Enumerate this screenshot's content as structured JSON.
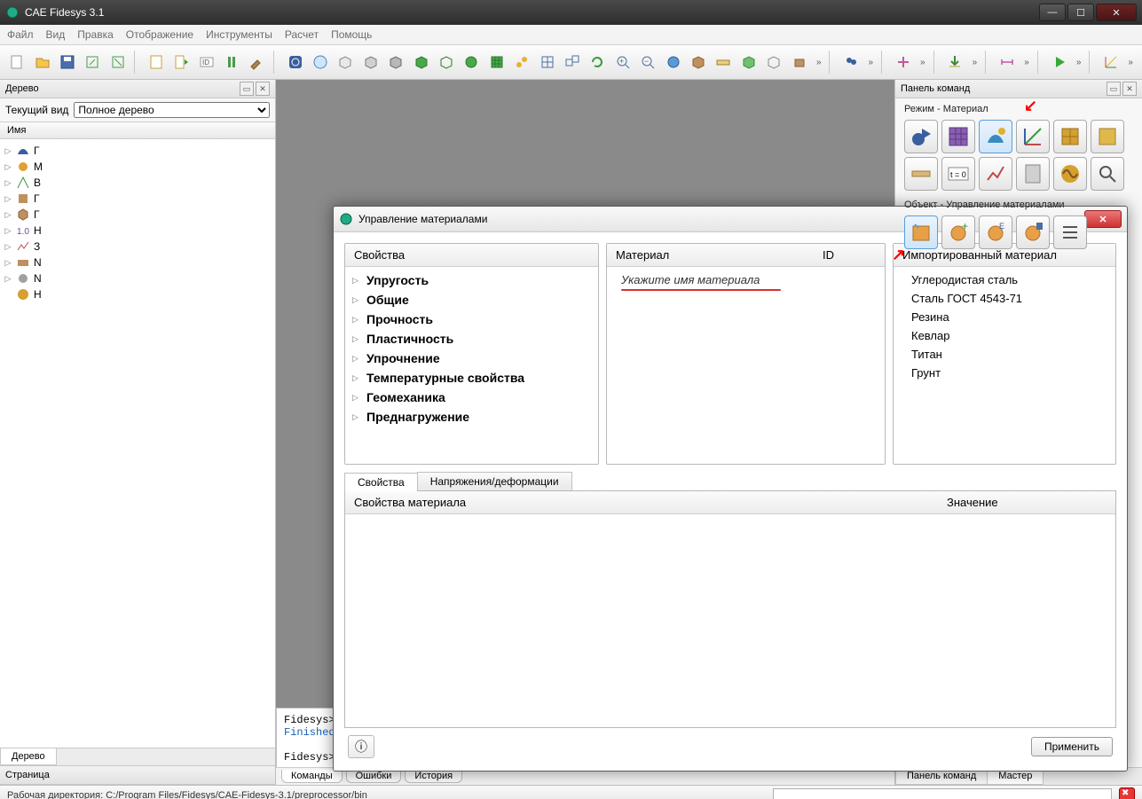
{
  "title": "CAE Fidesys 3.1",
  "menu": [
    "Файл",
    "Вид",
    "Правка",
    "Отображение",
    "Инструменты",
    "Расчет",
    "Помощь"
  ],
  "leftdock": {
    "title": "Дерево",
    "view_label": "Текущий вид",
    "view_value": "Полное дерево",
    "tree_header": "Имя",
    "tree_items": [
      "Г",
      "М",
      "В",
      "Г",
      "Г",
      "Н",
      "З",
      "N",
      "N",
      "Н"
    ],
    "tabs": [
      "Дерево"
    ],
    "page_label": "Страница"
  },
  "rightdock": {
    "title": "Панель команд",
    "mode_label": "Режим - Материал",
    "object_label": "Объект - Управление материалами",
    "bottom_tabs": [
      "Панель команд",
      "Мастер"
    ]
  },
  "dialog": {
    "title": "Управление материалами",
    "props_header": "Свойства",
    "prop_groups": [
      "Упругость",
      "Общие",
      "Прочность",
      "Пластичность",
      "Упрочнение",
      "Температурные свойства",
      "Геомеханика",
      "Преднагружение"
    ],
    "material_header": "Материал",
    "id_header": "ID",
    "material_placeholder": "Укажите имя материала",
    "imported_header": "Импортированный материал",
    "imported": [
      "Углеродистая сталь",
      "Сталь ГОСТ 4543-71",
      "Резина",
      "Кевлар",
      "Титан",
      "Грунт"
    ],
    "tab_props": "Свойства",
    "tab_stress": "Напряжения/деформации",
    "col_props": "Свойства материала",
    "col_value": "Значение",
    "apply": "Применить"
  },
  "console": {
    "line1": "Fidesys> undo group end",
    "line2": "Finished Command: undo group end",
    "line3": "",
    "line4": "Fidesys>",
    "tabs": [
      "Команды",
      "Ошибки",
      "История"
    ]
  },
  "status": {
    "text": "Рабочая директория: C:/Program Files/Fidesys/CAE-Fidesys-3.1/preprocessor/bin"
  }
}
